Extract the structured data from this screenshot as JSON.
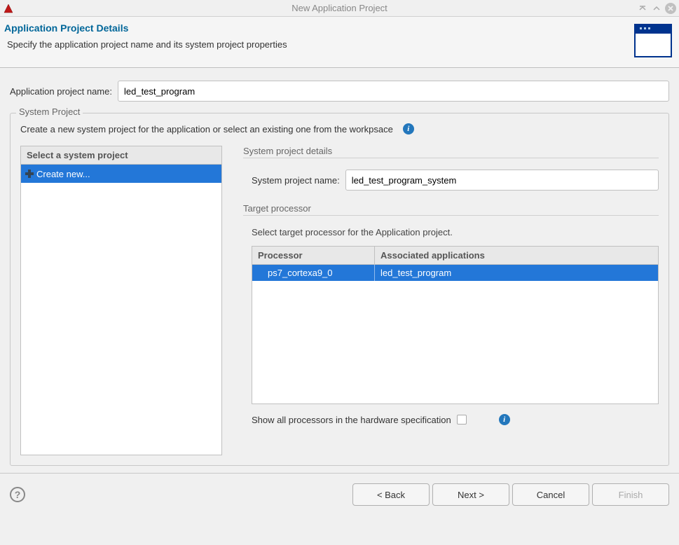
{
  "window": {
    "title": "New Application Project"
  },
  "header": {
    "title": "Application Project Details",
    "description": "Specify the application project name and its system project properties"
  },
  "form": {
    "app_project_name_label": "Application project name:",
    "app_project_name_value": "led_test_program"
  },
  "system_project": {
    "legend": "System Project",
    "description": "Create a new system project for the application or select an existing one from the workpsace",
    "left_panel": {
      "header": "Select a system project",
      "items": [
        "Create new..."
      ]
    },
    "right_panel": {
      "details_title": "System project details",
      "name_label": "System project name:",
      "name_value": "led_test_program_system",
      "target_title": "Target processor",
      "target_desc": "Select target processor for the Application project.",
      "table": {
        "columns": [
          "Processor",
          "Associated applications"
        ],
        "rows": [
          {
            "processor": "ps7_cortexa9_0",
            "app": "led_test_program"
          }
        ]
      },
      "show_all_label": "Show all processors in the hardware specification"
    }
  },
  "footer": {
    "back": "< Back",
    "next": "Next >",
    "cancel": "Cancel",
    "finish": "Finish"
  }
}
